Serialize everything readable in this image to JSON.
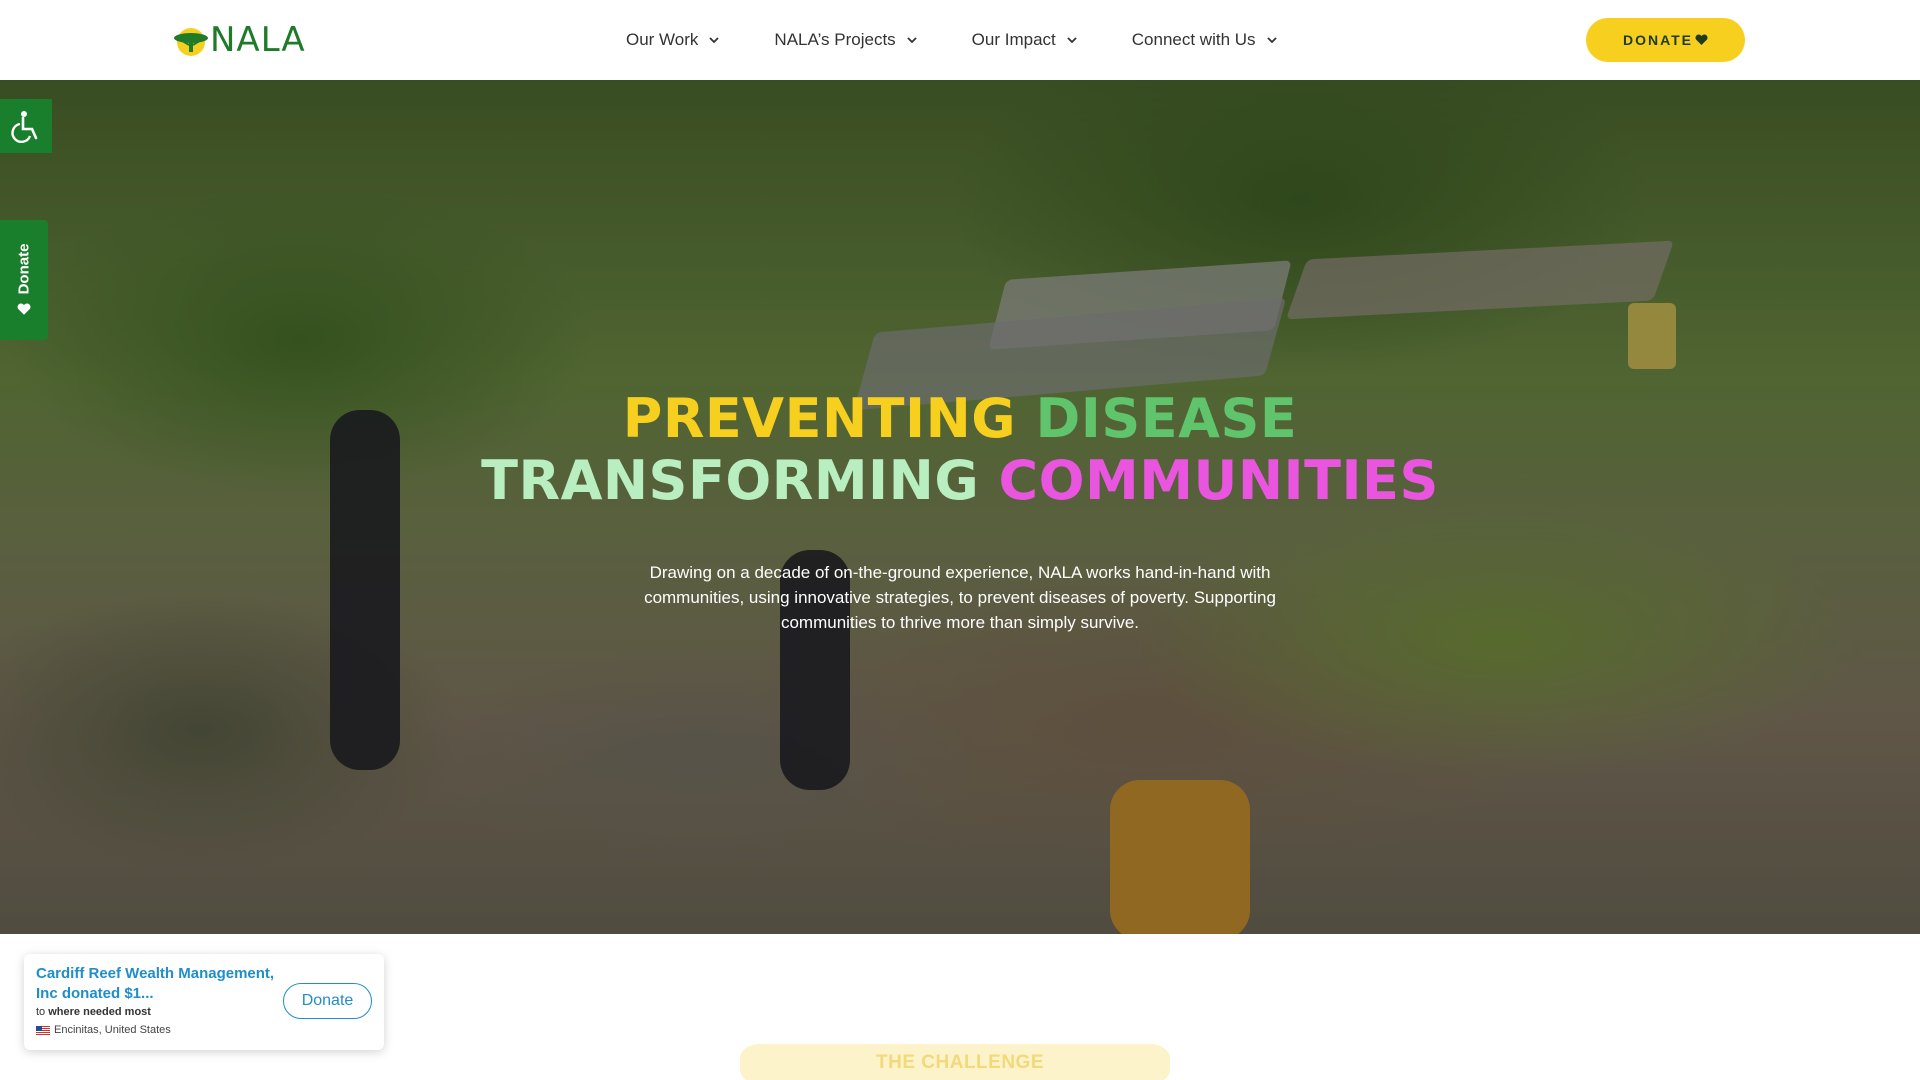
{
  "header": {
    "logo_text": "NALA",
    "nav": [
      {
        "label": "Our Work"
      },
      {
        "label": "NALA’s Projects"
      },
      {
        "label": "Our Impact"
      },
      {
        "label": "Connect with Us"
      }
    ],
    "donate_label": "DONATE"
  },
  "hero": {
    "title_line1_a": "PREVENTING",
    "title_line1_b": "DISEASE",
    "title_line2_a": "TRANSFORMING",
    "title_line2_b": "COMMUNITIES",
    "subtitle": "Drawing on a decade of on-the-ground experience, NALA works hand-in-hand with communities, using innovative strategies, to prevent diseases of poverty. Supporting communities to thrive more than simply survive."
  },
  "side_tabs": {
    "donate_label": "Donate"
  },
  "notification": {
    "title": "Cardiff Reef Wealth Management, Inc donated $1...",
    "to_prefix": "to",
    "to_target": "where needed most",
    "location": "Encinitas, United States",
    "button_label": "Donate"
  },
  "section": {
    "challenge_label": "THE CHALLENGE"
  },
  "colors": {
    "brand_green": "#1a7f2c",
    "accent_yellow": "#f7cf1f",
    "title_green": "#5fc46b",
    "title_mint": "#b9efc0",
    "title_pink": "#e955de",
    "notif_blue": "#1f8ec9"
  },
  "icons": [
    "accessibility-icon",
    "chevron-down-icon",
    "heart-icon",
    "flag-us-icon",
    "logo-acacia-icon"
  ]
}
